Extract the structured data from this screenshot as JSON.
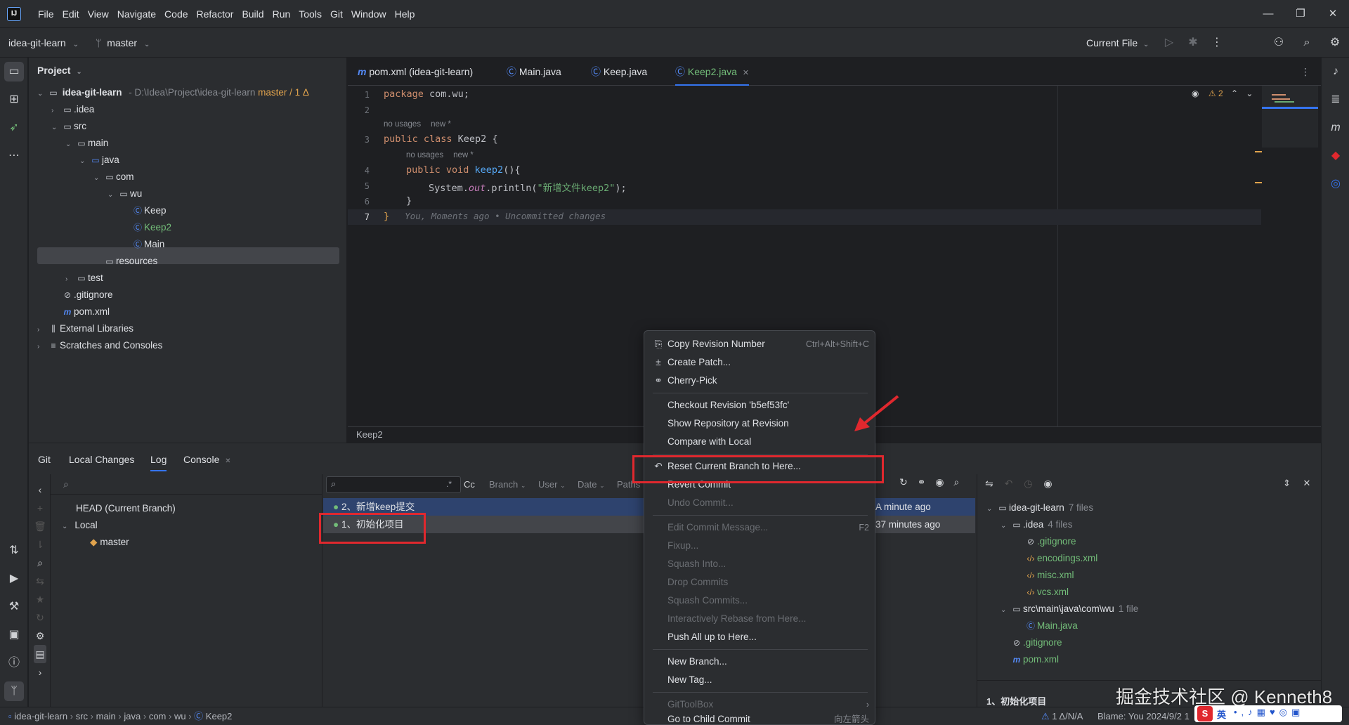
{
  "menu": [
    "File",
    "Edit",
    "View",
    "Navigate",
    "Code",
    "Refactor",
    "Build",
    "Run",
    "Tools",
    "Git",
    "Window",
    "Help"
  ],
  "toolbar": {
    "project_name": "idea-git-learn",
    "branch": "master",
    "run_config": "Current File"
  },
  "project_panel": {
    "title": "Project",
    "root_name": "idea-git-learn",
    "root_path": "- D:\\Idea\\Project\\idea-git-learn",
    "root_branch": "master / 1 Δ",
    "items": {
      "idea": ".idea",
      "src": "src",
      "main": "main",
      "java": "java",
      "com": "com",
      "wu": "wu",
      "keep": "Keep",
      "keep2": "Keep2",
      "main_class": "Main",
      "resources": "resources",
      "test": "test",
      "gitignore": ".gitignore",
      "pom": "pom.xml",
      "ext_libs": "External Libraries",
      "scratches": "Scratches and Consoles"
    }
  },
  "editor": {
    "tabs": [
      "pom.xml (idea-git-learn)",
      "Main.java",
      "Keep.java",
      "Keep2.java"
    ],
    "active_tab": "Keep2.java",
    "warnings": "2",
    "hints": {
      "class_usages": "no usages",
      "class_new": "new *",
      "method_usages": "no usages",
      "method_new": "new *"
    },
    "lines": {
      "l1_kw": "package",
      "l1_rest": " com.wu;",
      "l3_kw": "public class",
      "l3_rest": " Keep2 {",
      "l4_kw": "public void",
      "l4_meth": " keep2",
      "l4_rest": "(){",
      "l5_pre": "System.",
      "l5_field": "out",
      "l5_mid": ".println(",
      "l5_str": "\"新增文件keep2\"",
      "l5_end": ");",
      "l6": "}",
      "l7": "}",
      "blame": "You, Moments ago • Uncommitted changes"
    },
    "line_numbers": [
      "1",
      "2",
      "3",
      "4",
      "5",
      "6",
      "7"
    ],
    "breadcrumb": "Keep2"
  },
  "bottom": {
    "tabs": [
      "Git",
      "Local Changes",
      "Log",
      "Console"
    ],
    "branches": {
      "head": "HEAD (Current Branch)",
      "local": "Local",
      "master": "master"
    },
    "filters": {
      "regex": ".*",
      "case": "Cc",
      "branch": "Branch",
      "user": "User",
      "date": "Date",
      "paths": "Paths"
    },
    "commits": [
      {
        "message": "2、新增keep提交",
        "time": "A minute ago"
      },
      {
        "message": "1、初始化项目",
        "time": "37 minutes ago"
      }
    ],
    "changes_tree": {
      "root": "idea-git-learn",
      "root_count": "7 files",
      "idea": ".idea",
      "idea_count": "4 files",
      "idea_files": [
        ".gitignore",
        "encodings.xml",
        "misc.xml",
        "vcs.xml"
      ],
      "src_path": "src\\main\\java\\com\\wu",
      "src_count": "1 file",
      "main_java": "Main.java",
      "gitignore": ".gitignore",
      "pom": "pom.xml"
    },
    "commit_detail": "1、初始化项目"
  },
  "context_menu": {
    "items": [
      {
        "label": "Copy Revision Number",
        "shortcut": "Ctrl+Alt+Shift+C"
      },
      {
        "label": "Create Patch..."
      },
      {
        "label": "Cherry-Pick"
      },
      {
        "label": "Checkout Revision 'b5ef53fc'"
      },
      {
        "label": "Show Repository at Revision"
      },
      {
        "label": "Compare with Local"
      },
      {
        "label": "Reset Current Branch to Here..."
      },
      {
        "label": "Revert Commit"
      },
      {
        "label": "Undo Commit..."
      },
      {
        "label": "Edit Commit Message...",
        "shortcut": "F2"
      },
      {
        "label": "Fixup..."
      },
      {
        "label": "Squash Into..."
      },
      {
        "label": "Drop Commits"
      },
      {
        "label": "Squash Commits..."
      },
      {
        "label": "Interactively Rebase from Here..."
      },
      {
        "label": "Push All up to Here..."
      },
      {
        "label": "New Branch..."
      },
      {
        "label": "New Tag..."
      },
      {
        "label": "GitToolBox"
      },
      {
        "label": "Go to Child Commit",
        "shortcut": "向左箭头"
      }
    ]
  },
  "statusbar": {
    "crumbs": [
      "idea-git-learn",
      "src",
      "main",
      "java",
      "com",
      "wu",
      "Keep2"
    ],
    "vcs": "1 Δ/N/A",
    "blame": "Blame: You 2024/9/2 1"
  },
  "watermark": "掘金技术社区 @ Kenneth8",
  "ime": {
    "lang": "英"
  },
  "colors": {
    "accent": "#3574f0",
    "annotation_red": "#e0282e",
    "panel_bg": "#2b2d30",
    "editor_bg": "#1e1f22"
  }
}
